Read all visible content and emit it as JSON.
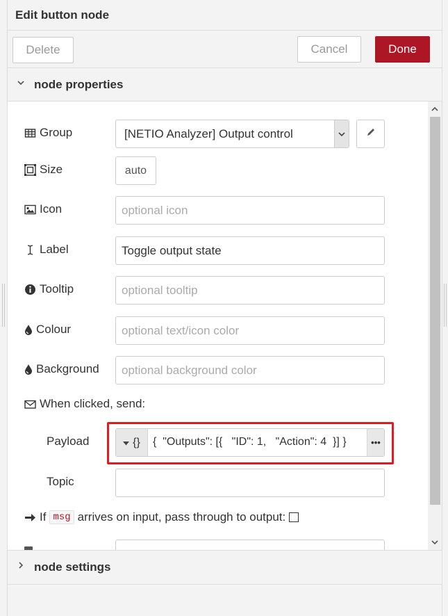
{
  "tray": {
    "title": "Edit button node",
    "delete_label": "Delete",
    "cancel_label": "Cancel",
    "done_label": "Done"
  },
  "sections": {
    "properties_label": "node properties",
    "settings_label": "node settings"
  },
  "form": {
    "group": {
      "label": "Group",
      "value": "[NETIO Analyzer] Output control"
    },
    "size": {
      "label": "Size",
      "value": "auto"
    },
    "icon": {
      "label": "Icon",
      "placeholder": "optional icon"
    },
    "label": {
      "label": "Label",
      "value": "Toggle output state"
    },
    "tooltip": {
      "label": "Tooltip",
      "placeholder": "optional tooltip"
    },
    "colour": {
      "label": "Colour",
      "placeholder": "optional text/icon color"
    },
    "background": {
      "label": "Background",
      "placeholder": "optional background color"
    },
    "when_clicked": {
      "label": "When clicked, send:"
    },
    "payload": {
      "label": "Payload",
      "type_icon": "{}",
      "value": "{  \"Outputs\": [{   \"ID\": 1,   \"Action\": 4  }] }",
      "more": "•••"
    },
    "topic": {
      "label": "Topic",
      "value": ""
    },
    "passthrough": {
      "prefix": "If",
      "code": "msg",
      "suffix": "arrives on input, pass through to output:",
      "checked": false
    }
  },
  "colors": {
    "accent": "#ad1625",
    "highlight": "#e01b24"
  },
  "icons": {
    "group": "table-icon",
    "size": "resize-icon",
    "icon": "image-icon",
    "label": "text-cursor-icon",
    "tooltip": "info-circle-icon",
    "colour": "tint-icon",
    "background": "tint-icon",
    "when_clicked": "envelope-icon",
    "passthrough": "arrow-right-icon",
    "edit": "pencil-icon",
    "dropdown": "caret-down-icon"
  }
}
